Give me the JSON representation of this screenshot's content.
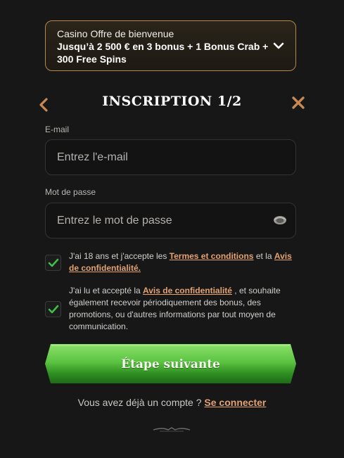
{
  "bonus": {
    "title": "Casino Offre de bienvenue",
    "description": "Jusqu’à 2 500 € en 3 bonus + 1 Bonus Crab + 300 Free Spins"
  },
  "header": {
    "title": "Inscription 1/2"
  },
  "email": {
    "label": "E-mail",
    "placeholder": "Entrez l'e-mail",
    "value": ""
  },
  "password": {
    "label": "Mot de passe",
    "placeholder": "Entrez le mot de passe",
    "value": ""
  },
  "consent1": {
    "checked": true,
    "text_before": "J'ai 18 ans et j'accepte les ",
    "link1": "Termes et conditions",
    "text_middle": " et la ",
    "link2": "Avis de confidentialité."
  },
  "consent2": {
    "checked": true,
    "text_before": "J'ai lu et accepté la ",
    "link": "Avis de confidentialité",
    "text_after": " , et souhaite également recevoir périodiquement des bonus, des promotions, ou d'autres informations par tout moyen de communication."
  },
  "next_button": {
    "label": "Étape suivante"
  },
  "login": {
    "prompt": "Vous avez déjà un compte ? ",
    "link": "Se connecter"
  },
  "colors": {
    "accent": "#e3a272",
    "border_gold": "#b7884a",
    "button_green": "#4fb83a",
    "check_green": "#3fbf4a",
    "background": "#171718"
  },
  "icons": {
    "bonus_toggle": "chevron-down-icon",
    "back": "chevron-left-icon",
    "close": "close-icon",
    "password_toggle": "eye-icon",
    "check": "check-icon"
  }
}
